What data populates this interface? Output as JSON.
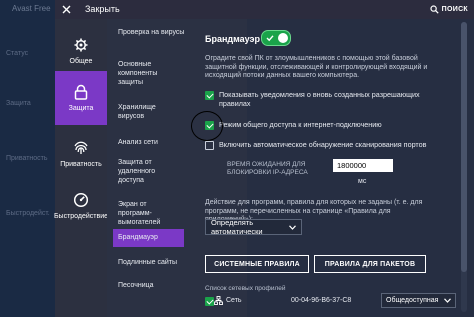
{
  "background": {
    "app_title": "Avast Free",
    "strip_labels": [
      "Статус",
      "Защита",
      "Приватность",
      "Быстродейст."
    ]
  },
  "header": {
    "close_label": "Закрыть",
    "search_label": "ПОИСК"
  },
  "categories": [
    {
      "label": "Общее",
      "icon": "gear-icon"
    },
    {
      "label": "Защита",
      "icon": "lock-icon",
      "active": true
    },
    {
      "label": "Приватность",
      "icon": "fingerprint-icon"
    },
    {
      "label": "Быстродействие",
      "icon": "speedometer-icon"
    }
  ],
  "subsections": [
    "Проверка на вирусы",
    "Основные компоненты защиты",
    "Хранилище вирусов",
    "Анализ сети",
    "Защита от удаленного доступа",
    "Экран от программ-вымогателей",
    "Брандмауэр",
    "Подлинные сайты",
    "Песочница"
  ],
  "firewall": {
    "title": "Брандмауэр",
    "enabled": true,
    "description": "Оградите свой ПК от злоумышленников с помощью этой базовой защитной функции, отслеживающей и контролирующей входящий и исходящий потоки данных вашего компьютера.",
    "options": [
      {
        "label": "Показывать уведомления о вновь созданных разрешающих правилах",
        "checked": true
      },
      {
        "label": "Режим общего доступа к интернет-подключению",
        "checked": true
      },
      {
        "label": "Включить автоматическое обнаружение сканирования портов",
        "checked": false
      }
    ],
    "wait_label": "ВРЕМЯ ОЖИДАНИЯ ДЛЯ БЛОКИРОВКИ IP-АДРЕСА",
    "wait_value": "1800000",
    "wait_unit": "мс",
    "action_text": "Действие для программ, правила для которых не заданы (т. е. для программ, не перечисленных на странице «Правила для приложений»):",
    "action_select": "Определять автоматически",
    "system_rules_button": "СИСТЕМНЫЕ ПРАВИЛА",
    "packet_rules_button": "ПРАВИЛА ДЛЯ ПАКЕТОВ",
    "profiles_label": "Список сетевых профилей",
    "profile": {
      "name": "Сеть",
      "mac": "00-04-96-B6-37-C8",
      "type": "Общедоступная",
      "checked": true
    }
  },
  "colors": {
    "accent": "#7b39c6",
    "toggle_on": "#1aa34a",
    "header_bg": "#2c2c3e"
  }
}
